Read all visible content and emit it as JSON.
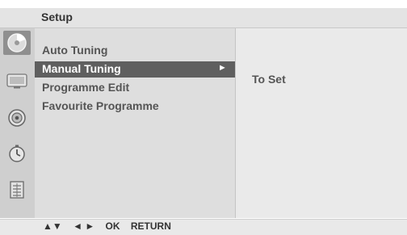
{
  "header": {
    "title": "Setup"
  },
  "sidebar": {
    "icons": [
      {
        "name": "setup-icon",
        "active": true
      },
      {
        "name": "picture-icon",
        "active": false
      },
      {
        "name": "audio-icon",
        "active": false
      },
      {
        "name": "time-icon",
        "active": false
      },
      {
        "name": "option-icon",
        "active": false
      }
    ]
  },
  "menu": {
    "items": [
      {
        "label": "Auto Tuning"
      },
      {
        "label": "Manual Tuning",
        "arrow": "►"
      },
      {
        "label": "Programme Edit"
      },
      {
        "label": "Favourite Programme"
      }
    ]
  },
  "subpanel": {
    "value": "To Set"
  },
  "footer": {
    "nav_arrows_updown": "▲▼",
    "nav_arrows_leftright": "◄ ►",
    "ok_label": "OK",
    "return_label": "RETURN"
  }
}
